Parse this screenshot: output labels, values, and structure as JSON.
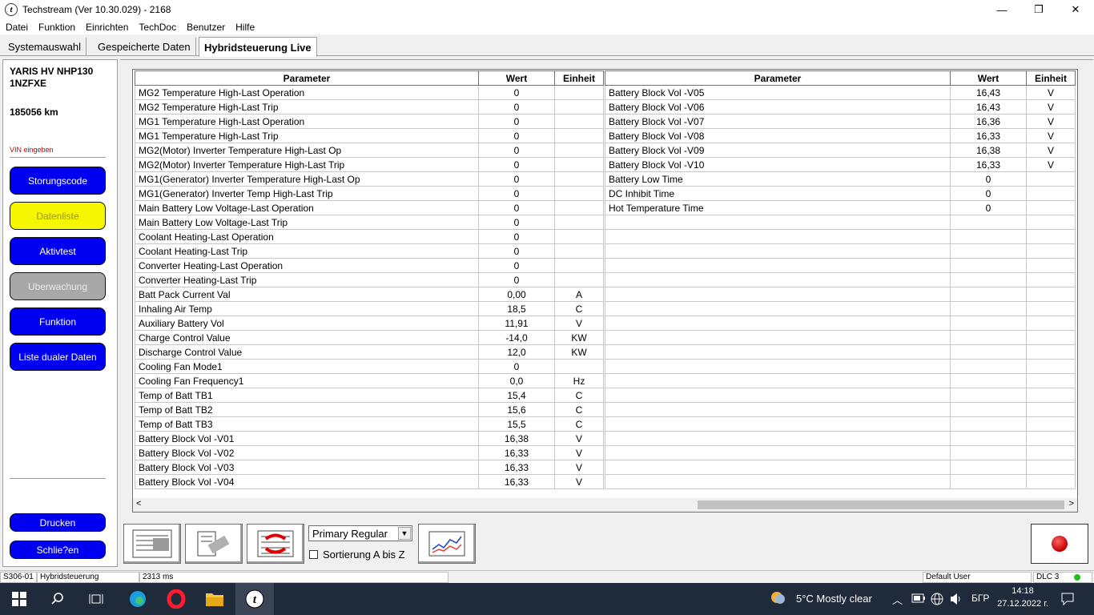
{
  "window": {
    "title": "Techstream (Ver 10.30.029) - 2168",
    "app_icon_letter": "t",
    "minimize": "—",
    "maximize": "❐",
    "close": "✕"
  },
  "menu": [
    "Datei",
    "Funktion",
    "Einrichten",
    "TechDoc",
    "Benutzer",
    "Hilfe"
  ],
  "tabs": [
    "Systemauswahl",
    "Gespeicherte Daten",
    "Hybridsteuerung Live"
  ],
  "vehicle": {
    "model": "YARIS HV NHP130 1NZFXE",
    "mileage": "185056 km",
    "vin_link": "VIN eingeben"
  },
  "sidebar_buttons": {
    "storungscode": "Storungscode",
    "datenliste": "Datenliste",
    "aktivtest": "Aktivtest",
    "uberwachung": "Uberwachung",
    "funktion": "Funktion",
    "liste_dualer_daten": "Liste dualer Daten",
    "drucken": "Drucken",
    "schliessen": "Schlie?en"
  },
  "table_headers": {
    "parameter": "Parameter",
    "value": "Wert",
    "unit": "Einheit"
  },
  "left_rows": [
    [
      "MG2 Temperature High-Last Operation",
      "0",
      ""
    ],
    [
      "MG2 Temperature High-Last Trip",
      "0",
      ""
    ],
    [
      "MG1 Temperature High-Last Operation",
      "0",
      ""
    ],
    [
      "MG1 Temperature High-Last Trip",
      "0",
      ""
    ],
    [
      "MG2(Motor) Inverter Temperature High-Last Op",
      "0",
      ""
    ],
    [
      "MG2(Motor) Inverter Temperature High-Last Trip",
      "0",
      ""
    ],
    [
      "MG1(Generator) Inverter Temperature High-Last Op",
      "0",
      ""
    ],
    [
      "MG1(Generator) Inverter Temp High-Last Trip",
      "0",
      ""
    ],
    [
      "Main Battery Low Voltage-Last Operation",
      "0",
      ""
    ],
    [
      "Main Battery Low Voltage-Last Trip",
      "0",
      ""
    ],
    [
      "Coolant Heating-Last Operation",
      "0",
      ""
    ],
    [
      "Coolant Heating-Last Trip",
      "0",
      ""
    ],
    [
      "Converter Heating-Last Operation",
      "0",
      ""
    ],
    [
      "Converter Heating-Last Trip",
      "0",
      ""
    ],
    [
      "Batt Pack Current Val",
      "0,00",
      "A"
    ],
    [
      "Inhaling Air Temp",
      "18,5",
      "C"
    ],
    [
      "Auxiliary Battery Vol",
      "11,91",
      "V"
    ],
    [
      "Charge Control Value",
      "-14,0",
      "KW"
    ],
    [
      "Discharge Control Value",
      "12,0",
      "KW"
    ],
    [
      "Cooling Fan Mode1",
      "0",
      ""
    ],
    [
      "Cooling Fan Frequency1",
      "0,0",
      "Hz"
    ],
    [
      "Temp of Batt TB1",
      "15,4",
      "C"
    ],
    [
      "Temp of Batt TB2",
      "15,6",
      "C"
    ],
    [
      "Temp of Batt TB3",
      "15,5",
      "C"
    ],
    [
      "Battery Block Vol -V01",
      "16,38",
      "V"
    ],
    [
      "Battery Block Vol -V02",
      "16,33",
      "V"
    ],
    [
      "Battery Block Vol -V03",
      "16,33",
      "V"
    ],
    [
      "Battery Block Vol -V04",
      "16,33",
      "V"
    ]
  ],
  "right_rows": [
    [
      "Battery Block Vol -V05",
      "16,43",
      "V"
    ],
    [
      "Battery Block Vol -V06",
      "16,43",
      "V"
    ],
    [
      "Battery Block Vol -V07",
      "16,36",
      "V"
    ],
    [
      "Battery Block Vol -V08",
      "16,33",
      "V"
    ],
    [
      "Battery Block Vol -V09",
      "16,38",
      "V"
    ],
    [
      "Battery Block Vol -V10",
      "16,33",
      "V"
    ],
    [
      "Battery Low Time",
      "0",
      ""
    ],
    [
      "DC Inhibit Time",
      "0",
      ""
    ],
    [
      "Hot Temperature Time",
      "0",
      ""
    ]
  ],
  "toolbar": {
    "display_mode": "Primary Regular",
    "sort_label": "Sortierung A bis Z",
    "sort_checked": false
  },
  "statusbar": {
    "code": "S306-01",
    "system": "Hybridsteuerung",
    "interval": "2313 ms",
    "user": "Default User",
    "dlc": "DLC 3"
  },
  "taskbar": {
    "weather": "5°C  Mostly clear",
    "language": "БГР",
    "time": "14:18",
    "date": "27.12.2022 г."
  },
  "colors": {
    "sidebar_blue": "#0000f0",
    "sidebar_yellow": "#f6f600",
    "sidebar_gray": "#a8a8a8",
    "record_red": "#c00000",
    "taskbar": "#1f2a3a"
  }
}
